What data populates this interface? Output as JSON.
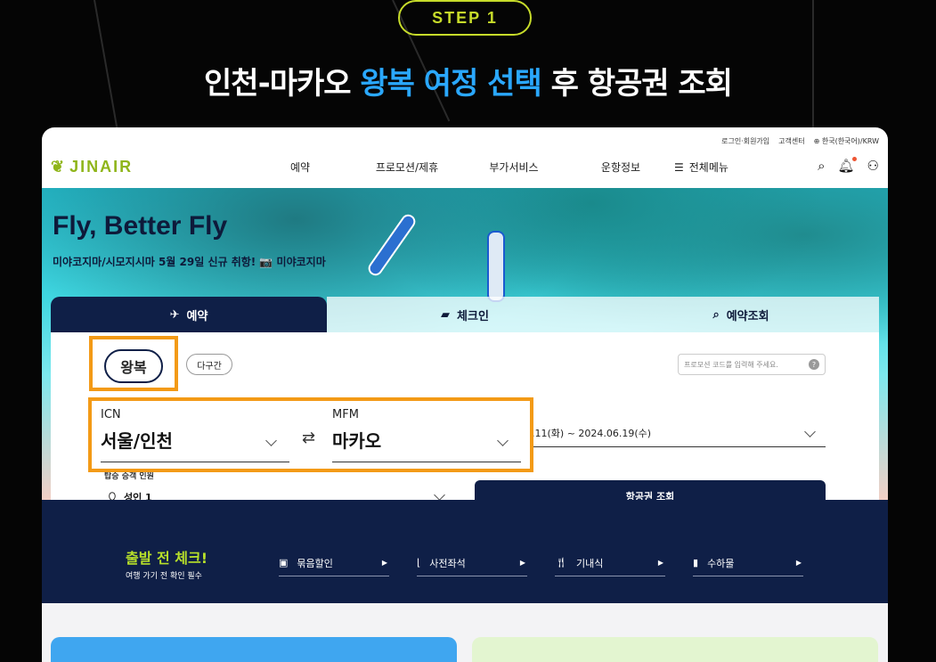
{
  "step_label": "STEP 1",
  "headline": {
    "part1": "인천-마카오 ",
    "accent": "왕복 여정 선택",
    "part2": " 후 항공권 조회"
  },
  "header": {
    "util_links": [
      "로그인·회원가입",
      "고객센터",
      "한국(한국어)/KRW"
    ],
    "logo": "JINAIR",
    "nav": [
      "예약",
      "프로모션/제휴",
      "부가서비스",
      "운항정보"
    ],
    "all_menu": "전체메뉴"
  },
  "hero": {
    "title": "Fly, Better Fly",
    "subtitle": "미야코지마/시모지시마 5월 29일 신규 취항! 📷 미야코지마"
  },
  "booking": {
    "tabs": [
      "예약",
      "체크인",
      "예약조회"
    ],
    "trip_types": [
      "왕복",
      "다구간"
    ],
    "promo_placeholder": "프로모션 코드를 입력해 주세요.",
    "origin": {
      "code": "ICN",
      "city": "서울/인천"
    },
    "destination": {
      "code": "MFM",
      "city": "마카오"
    },
    "dates": ".11(화) ~ 2024.06.19(수)",
    "pax_label": "탑승 승객 인원",
    "pax_value": "성인 1",
    "search_label": "항공권 조회"
  },
  "checkbar": {
    "title": "출발 전 체크!",
    "subtitle": "여행 가기 전 확인 필수",
    "items": [
      "묶음할인",
      "사전좌석",
      "기내식",
      "수하물"
    ]
  },
  "colors": {
    "accent_blue": "#2aa8ff",
    "navy": "#0f1f47",
    "highlight": "#f39a16",
    "lime": "#c7dc2a"
  }
}
